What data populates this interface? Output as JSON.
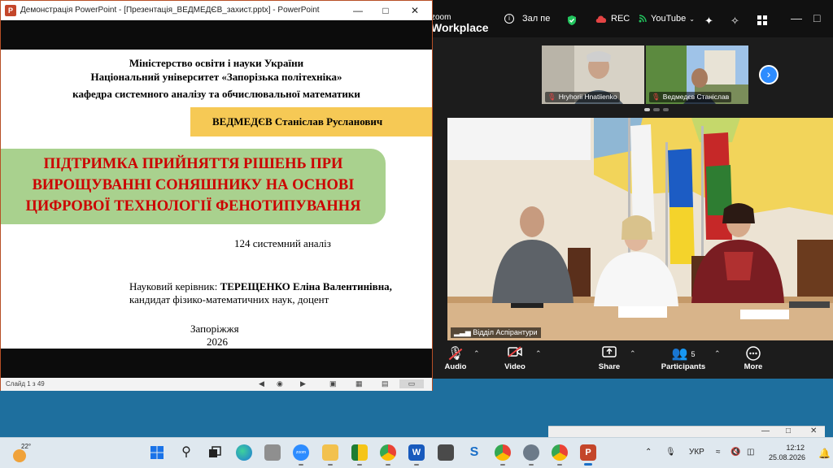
{
  "zoom": {
    "brand_small": "zoom",
    "brand_large": "Workplace",
    "room_name": "Зал пе",
    "rec_label": "REC",
    "youtube_label": "YouTube",
    "participants": [
      {
        "name": "Hryhorii Hnatiienko"
      },
      {
        "name": "Ведмедєв Станіслав"
      }
    ],
    "main_video_label": "Відділ Аспірантури",
    "toolbar": {
      "audio": "Audio",
      "video": "Video",
      "share": "Share",
      "participants": "Participants",
      "participants_count": "5",
      "more": "More"
    },
    "colors": {
      "accent": "#2d8cff",
      "mic_off": "#e44444",
      "shield": "#22c55e"
    }
  },
  "powerpoint": {
    "window_title": "Демонстрація PowerPoint - [Презентація_ВЕДМЕДЄВ_захист.pptx] - PowerPoint",
    "app_icon": "P",
    "slide": {
      "ministry": "Міністерство освіти і науки України",
      "university": "Національний університет «Запорізька політехніка»",
      "department": "кафедра системного аналізу та обчислювальної математики",
      "author": "ВЕДМЕДЄВ  Станіслав Русланович",
      "topic_line1": "ПІДТРИМКА ПРИЙНЯТТЯ РІШЕНЬ ПРИ",
      "topic_line2": "ВИРОЩУВАННІ СОНЯШНИКУ НА ОСНОВІ",
      "topic_line3": "ЦИФРОВОЇ ТЕХНОЛОГІЇ ФЕНОТИПУВАННЯ",
      "specialty": "124 системний аналіз",
      "supervisor_label": "Науковий керівник: ",
      "supervisor_name": "ТЕРЕЩЕНКО Еліна Валентинівна,",
      "supervisor_degree": "кандидат фізико-математичних наук, доцент",
      "city": "Запоріжжя",
      "year": "2026"
    },
    "status": {
      "slide_counter": "Слайд 1 з 49"
    },
    "colors": {
      "topic_bg": "#a9d18e",
      "topic_text": "#cc0000",
      "author_bg": "#f6c955"
    }
  },
  "taskbar": {
    "temperature": "22°",
    "language": "УКР",
    "time": "12:12",
    "date": "25.08.2026",
    "zoom_icon_label": "zoom"
  }
}
